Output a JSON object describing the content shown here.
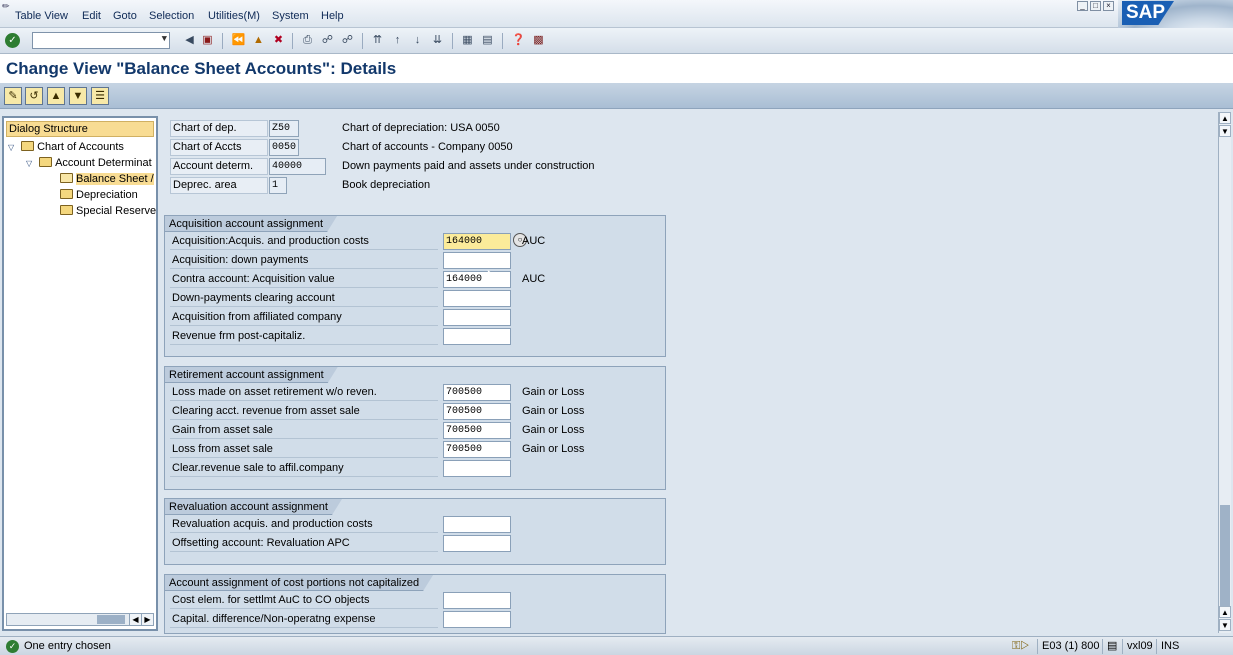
{
  "menu": [
    "Table View",
    "Edit",
    "Goto",
    "Selection",
    "Utilities(M)",
    "System",
    "Help"
  ],
  "brand": {
    "logo_text": "SAP",
    "color": "#1a5fb4"
  },
  "command_field": {
    "value": ""
  },
  "toolbar_icons": [
    "enter-icon",
    "back-icon",
    "save-icon",
    "back-nav-icon",
    "exit-icon",
    "cancel-icon",
    "print-icon",
    "find-icon",
    "find-next-icon",
    "first-page-icon",
    "prev-page-icon",
    "next-page-icon",
    "last-page-icon",
    "new-session-icon",
    "shortcut-icon",
    "help-icon",
    "layout-icon"
  ],
  "title": "Change View \"Balance Sheet Accounts\": Details",
  "app_toolbar_icons": [
    "display-change-icon",
    "other-entry-icon",
    "prev-entry-icon",
    "next-entry-icon",
    "overview-icon"
  ],
  "tree": {
    "header": "Dialog Structure",
    "items": [
      {
        "label": "Chart of Accounts",
        "level": 0
      },
      {
        "label": "Account Determinat",
        "level": 1
      },
      {
        "label": "Balance Sheet /",
        "level": 2
      },
      {
        "label": "Depreciation",
        "level": 2
      },
      {
        "label": "Special Reserve",
        "level": 2
      }
    ]
  },
  "header_fields": [
    {
      "label": "Chart of dep.",
      "value": "Z50",
      "desc": "Chart of depreciation: USA 0050"
    },
    {
      "label": "Chart of Accts",
      "value": "0050",
      "desc": "Chart of accounts - Company 0050"
    },
    {
      "label": "Account determ.",
      "value": "40000",
      "desc": "Down payments paid and assets under construction"
    },
    {
      "label": "Deprec. area",
      "value": "1",
      "desc": "Book depreciation"
    }
  ],
  "groups": [
    {
      "title": "Acquisition account assignment",
      "rows": [
        {
          "label": "Acquisition:Acquis. and production costs",
          "value": "164000",
          "desc": "AUC"
        },
        {
          "label": "Acquisition: down payments",
          "value": "",
          "desc": ""
        },
        {
          "label": "Contra account: Acquisition value",
          "value": "164000",
          "desc": "AUC"
        },
        {
          "label": "Down-payments clearing account",
          "value": "",
          "desc": ""
        },
        {
          "label": "Acquisition from affiliated company",
          "value": "",
          "desc": ""
        },
        {
          "label": "Revenue frm post-capitaliz.",
          "value": "",
          "desc": ""
        }
      ]
    },
    {
      "title": "Retirement account assignment",
      "rows": [
        {
          "label": "Loss made on asset retirement w/o reven.",
          "value": "700500",
          "desc": "Gain or Loss"
        },
        {
          "label": "Clearing acct. revenue from asset sale",
          "value": "700500",
          "desc": "Gain or Loss"
        },
        {
          "label": "Gain from asset sale",
          "value": "700500",
          "desc": "Gain or Loss"
        },
        {
          "label": "Loss from asset sale",
          "value": "700500",
          "desc": "Gain or Loss"
        },
        {
          "label": "Clear.revenue sale to affil.company",
          "value": "",
          "desc": ""
        }
      ]
    },
    {
      "title": "Revaluation account assignment",
      "rows": [
        {
          "label": "Revaluation acquis. and production costs",
          "value": "",
          "desc": ""
        },
        {
          "label": "Offsetting account: Revaluation APC",
          "value": "",
          "desc": ""
        }
      ]
    },
    {
      "title": "Account assignment of cost portions not capitalized",
      "rows": [
        {
          "label": "Cost elem. for settlmt AuC to CO objects",
          "value": "",
          "desc": ""
        },
        {
          "label": "Capital. difference/Non-operatng expense",
          "value": "",
          "desc": ""
        }
      ]
    }
  ],
  "status": {
    "message": "One entry chosen",
    "system": "E03 (1) 800",
    "server": "vxl09",
    "mode": "INS"
  }
}
